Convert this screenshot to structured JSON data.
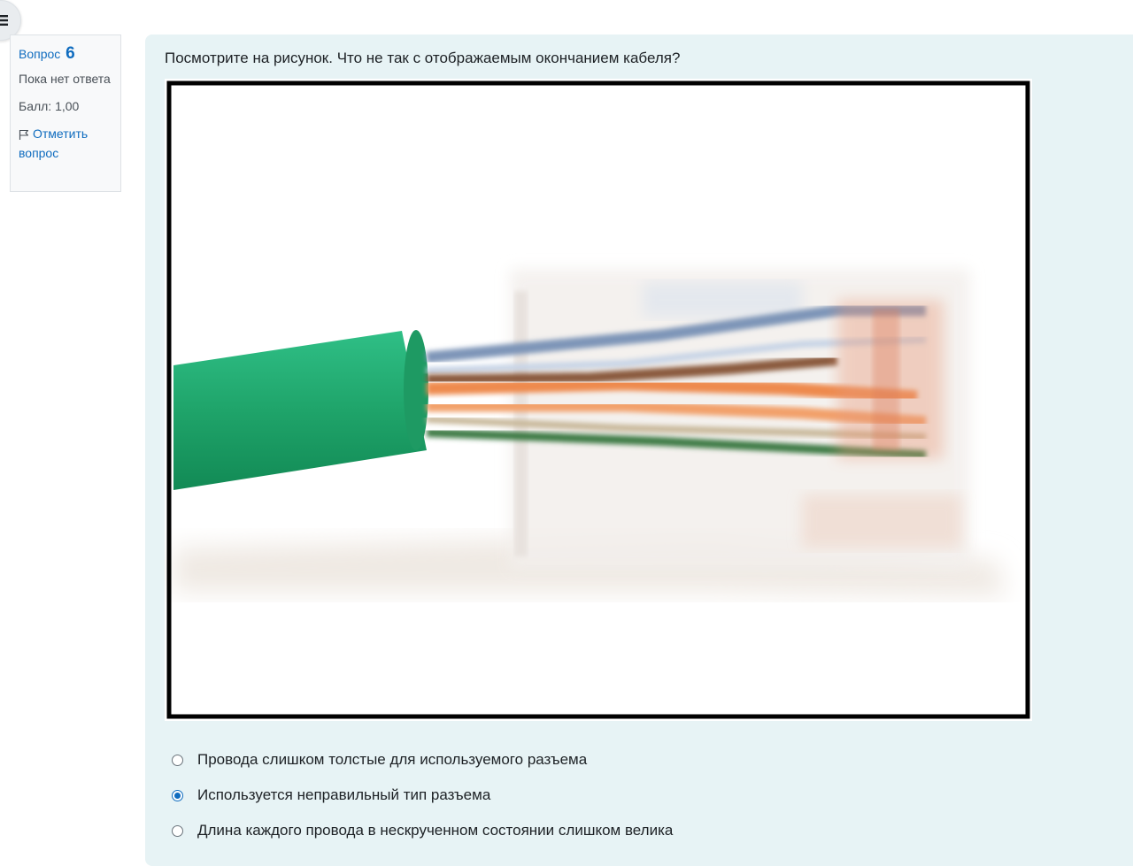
{
  "drawer": {
    "icon": "list-icon"
  },
  "question_info": {
    "label": "Вопрос",
    "number": "6",
    "state": "Пока нет ответа",
    "grade": "Балл: 1,00",
    "flag_label": "Отметить вопрос",
    "flag_icon": "flag-icon"
  },
  "question": {
    "text": "Посмотрите на рисунок. Что не так с отображаемым окончанием кабеля?",
    "image_icon": "cable-photo"
  },
  "answers": [
    {
      "label": "Провода слишком толстые для используемого разъема",
      "checked": false
    },
    {
      "label": "Используется неправильный тип разъема",
      "checked": true
    },
    {
      "label": "Длина каждого провода в нескрученном состоянии слишком велика",
      "checked": false
    }
  ],
  "colors": {
    "accent": "#0f6cbf",
    "question_bg": "#e7f3f5"
  }
}
